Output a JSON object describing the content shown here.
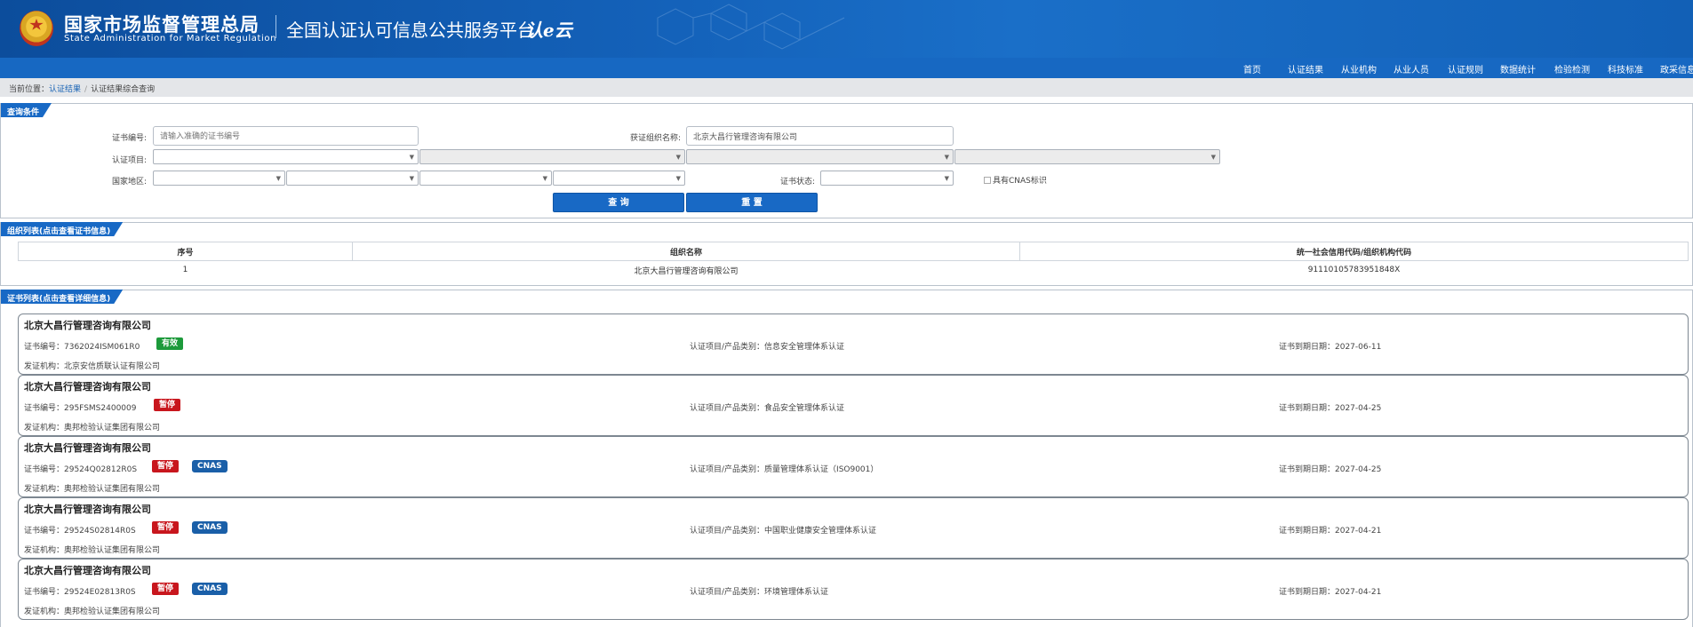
{
  "header": {
    "agency_cn": "国家市场监督管理总局",
    "agency_en": "State Administration  for  Market Regulation",
    "platform_title": "全国认证认可信息公共服务平台",
    "platform_logo_text": "认e云",
    "nav": [
      "首页",
      "认证结果",
      "从业机构",
      "从业人员",
      "认证规则",
      "数据统计",
      "检验检测",
      "科技标准",
      "政采信息"
    ]
  },
  "breadcrumb": {
    "prefix": "当前位置：",
    "level1": "认证结果",
    "separator": "/",
    "level2": "认证结果综合查询"
  },
  "query": {
    "title": "查询条件",
    "cert_no_label": "证书编号:",
    "cert_no_placeholder": "请输入准确的证书编号",
    "org_label": "获证组织名称:",
    "org_value": "北京大昌行管理咨询有限公司",
    "project_label": "认证项目:",
    "region_label": "国家地区:",
    "status_label": "证书状态:",
    "cnas_label": "具有CNAS标识",
    "search_btn": "查 询",
    "reset_btn": "重 置"
  },
  "org_list": {
    "title": "组织列表(点击查看证书信息)",
    "columns": [
      "序号",
      "组织名称",
      "统一社会信用代码/组织机构代码"
    ],
    "rows": [
      [
        "1",
        "北京大昌行管理咨询有限公司",
        "91110105783951848X"
      ]
    ]
  },
  "cert_list": {
    "title": "证书列表(点击查看详细信息)",
    "cards": [
      {
        "org": "北京大昌行管理咨询有限公司",
        "cert_no": "证书编号：7362024ISM061R0",
        "status": "有效",
        "cnas": "",
        "project": "认证项目/产品类别：信息安全管理体系认证",
        "expiry": "证书到期日期：2027-06-11",
        "issuer": "发证机构：北京安信质联认证有限公司"
      },
      {
        "org": "北京大昌行管理咨询有限公司",
        "cert_no": "证书编号：295FSMS2400009",
        "status": "暂停",
        "cnas": "",
        "project": "认证项目/产品类别：食品安全管理体系认证",
        "expiry": "证书到期日期：2027-04-25",
        "issuer": "发证机构：奥邦检验认证集团有限公司"
      },
      {
        "org": "北京大昌行管理咨询有限公司",
        "cert_no": "证书编号：29524Q02812R0S",
        "status": "暂停",
        "cnas": "CNAS",
        "project": "认证项目/产品类别：质量管理体系认证（ISO9001）",
        "expiry": "证书到期日期：2027-04-25",
        "issuer": "发证机构：奥邦检验认证集团有限公司"
      },
      {
        "org": "北京大昌行管理咨询有限公司",
        "cert_no": "证书编号：29524S02814R0S",
        "status": "暂停",
        "cnas": "CNAS",
        "project": "认证项目/产品类别：中国职业健康安全管理体系认证",
        "expiry": "证书到期日期：2027-04-21",
        "issuer": "发证机构：奥邦检验认证集团有限公司"
      },
      {
        "org": "北京大昌行管理咨询有限公司",
        "cert_no": "证书编号：29524E02813R0S",
        "status": "暂停",
        "cnas": "CNAS",
        "project": "认证项目/产品类别：环境管理体系认证",
        "expiry": "证书到期日期：2027-04-21",
        "issuer": "发证机构：奥邦检验认证集团有限公司"
      }
    ]
  },
  "colors": {
    "brand_blue": "#1869c5",
    "status_valid": "#1d9a3b",
    "status_suspended": "#c8161d",
    "cnas_badge": "#1a5fa8"
  }
}
